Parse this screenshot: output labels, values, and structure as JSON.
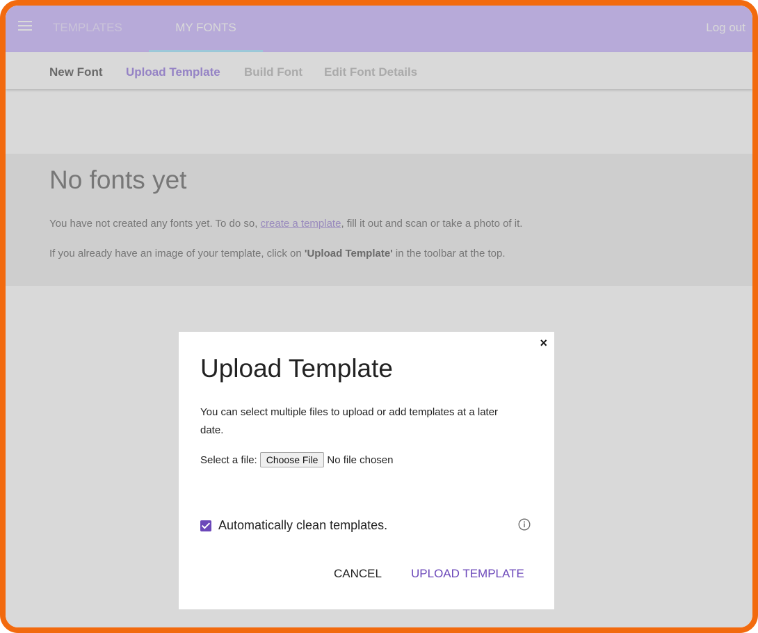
{
  "topbar": {
    "tabs": [
      {
        "label": "TEMPLATES"
      },
      {
        "label": "MY FONTS"
      }
    ],
    "logout_label": "Log out"
  },
  "subbar": {
    "items": [
      {
        "label": "New Font"
      },
      {
        "label": "Upload Template"
      },
      {
        "label": "Build Font"
      },
      {
        "label": "Edit Font Details"
      }
    ]
  },
  "content": {
    "heading": "No fonts yet",
    "p1_before": "You have not created any fonts yet. To do so, ",
    "p1_link": "create a template",
    "p1_after": ", fill it out and scan or take a photo of it.",
    "p2_before": "If you already have an image of your template, click on ",
    "p2_bold": "'Upload Template'",
    "p2_after": " in the toolbar at the top."
  },
  "dialog": {
    "title": "Upload Template",
    "description": "You can select multiple files to upload or add templates at a later date.",
    "file_label": "Select a file:",
    "choose_file_label": "Choose File",
    "no_file_text": "No file chosen",
    "checkbox_label": "Automatically clean templates.",
    "checkbox_checked": true,
    "cancel_label": "CANCEL",
    "upload_label": "UPLOAD TEMPLATE",
    "close_symbol": "×"
  },
  "colors": {
    "frame": "#f26a0e",
    "topbar": "#d7c8ff",
    "accent": "#6b47b9"
  }
}
